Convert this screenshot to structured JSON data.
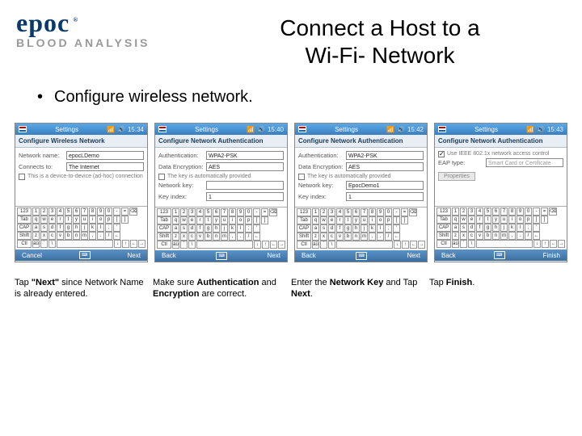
{
  "logo": {
    "brand": "epoc",
    "reg": "®",
    "subtitle": "BLOOD ANALYSIS"
  },
  "title_line1": "Connect a Host to a",
  "title_line2": "Wi-Fi- Network",
  "bullet": "Configure wireless network.",
  "screens": [
    {
      "settings": "Settings",
      "time": "15:34",
      "heading": "Configure Wireless Network",
      "rows": [
        {
          "label": "Network name:",
          "value": "epocLDemo"
        },
        {
          "label": "Connects to:",
          "value": "The Internet"
        }
      ],
      "checkbox": "This is a device-to-device (ad-hoc) connection",
      "checked": false,
      "bottom": {
        "left": "Cancel",
        "right": "Next"
      }
    },
    {
      "settings": "Settings",
      "time": "15:40",
      "heading": "Configure Network Authentication",
      "rows": [
        {
          "label": "Authentication:",
          "value": "WPA2-PSK"
        },
        {
          "label": "Data Encryption:",
          "value": "AES"
        }
      ],
      "checkbox": "The key is automatically provided",
      "checked": false,
      "rows2": [
        {
          "label": "Network key:",
          "value": ""
        },
        {
          "label": "Key index:",
          "value": "1"
        }
      ],
      "bottom": {
        "left": "Back",
        "right": "Next"
      }
    },
    {
      "settings": "Settings",
      "time": "15:42",
      "heading": "Configure Network Authentication",
      "rows": [
        {
          "label": "Authentication:",
          "value": "WPA2-PSK"
        },
        {
          "label": "Data Encryption:",
          "value": "AES"
        }
      ],
      "checkbox": "The key is automatically provided",
      "checked": false,
      "rows2": [
        {
          "label": "Network key:",
          "value": "EpocDemo1"
        },
        {
          "label": "Key index:",
          "value": "1"
        }
      ],
      "bottom": {
        "left": "Back",
        "right": "Next"
      }
    },
    {
      "settings": "Settings",
      "time": "15:43",
      "heading": "Configure Network Authentication",
      "checkbox": "Use IEEE 802.1x network access control",
      "checked": true,
      "rows": [
        {
          "label": "EAP type:",
          "value": "Smart Card or Certificate"
        }
      ],
      "propbtn": "Properties",
      "bottom": {
        "left": "Back",
        "right": "Finish"
      }
    }
  ],
  "kbd": {
    "r1": [
      "123",
      "1",
      "2",
      "3",
      "4",
      "5",
      "6",
      "7",
      "8",
      "9",
      "0",
      "-",
      "=",
      "⌫"
    ],
    "r2": [
      "Tab",
      "q",
      "w",
      "e",
      "r",
      "t",
      "y",
      "u",
      "i",
      "o",
      "p",
      "[",
      "]"
    ],
    "r3": [
      "CAP",
      "a",
      "s",
      "d",
      "f",
      "g",
      "h",
      "j",
      "k",
      "l",
      ";",
      "'"
    ],
    "r4": [
      "Shift",
      "z",
      "x",
      "c",
      "v",
      "b",
      "n",
      "m",
      ",",
      ".",
      "/",
      "←"
    ],
    "r5": [
      "Ctl",
      "áü",
      "`",
      "\\",
      " ",
      "↓",
      "↑",
      "←",
      "→"
    ]
  },
  "captions": [
    {
      "pre": "Tap ",
      "b": "\"Next\"",
      "post": " since Network Name is already entered."
    },
    {
      "pre": "Make sure ",
      "b": "Authentication",
      "mid": " and ",
      "b2": "Encryption",
      "post": " are correct."
    },
    {
      "pre": "Enter the ",
      "b": "Network Key",
      "mid": " and Tap ",
      "b2": "Next",
      "post": "."
    },
    {
      "pre": "Tap ",
      "b": "Finish",
      "post": "."
    }
  ]
}
